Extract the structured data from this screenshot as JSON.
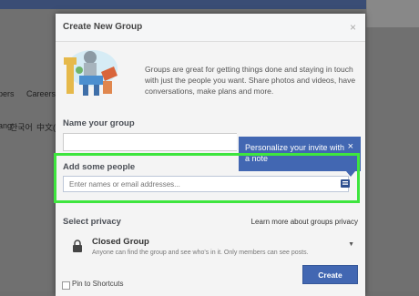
{
  "background": {
    "row1": [
      "pers",
      "Careers"
    ],
    "row2": [
      "ang",
      "한국어",
      "中文("
    ]
  },
  "dialog": {
    "title": "Create New Group",
    "close_glyph": "×",
    "intro": "Groups are great for getting things done and staying in touch with just the people you want. Share photos and videos, have conversations, make plans and more."
  },
  "name_group": {
    "label": "Name your group",
    "value": ""
  },
  "tooltip": {
    "text": "Personalize your invite with a note",
    "close_glyph": "×",
    "color": "#4267b2"
  },
  "add_people": {
    "label": "Add some people",
    "placeholder": "Enter names or email addresses...",
    "highlight_color": "#3ee53e"
  },
  "privacy": {
    "label": "Select privacy",
    "learn_more": "Learn more about groups privacy",
    "selected_title": "Closed Group",
    "selected_desc": "Anyone can find the group and see who's in it. Only members can see posts.",
    "chevron": "▼"
  },
  "footer": {
    "pin_label": "Pin to Shortcuts",
    "create_label": "Create",
    "button_color": "#4267b2"
  },
  "icons": [
    "close-icon",
    "address-book-icon",
    "lock-icon",
    "chevron-down-icon",
    "groups-illustration"
  ]
}
